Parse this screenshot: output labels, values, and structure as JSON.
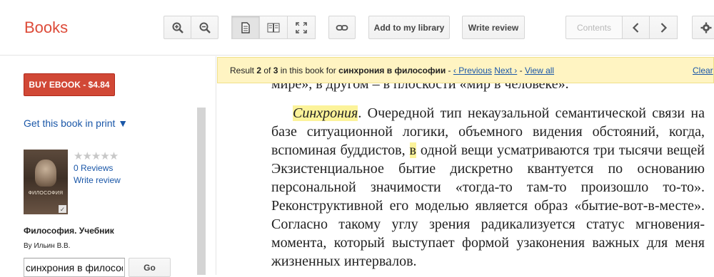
{
  "app": {
    "title": "Books"
  },
  "toolbar": {
    "zoom_in_icon": "zoom-in-icon",
    "zoom_out_icon": "zoom-out-icon",
    "view_single_icon": "single-page-icon",
    "view_two_icon": "two-page-icon",
    "fullscreen_icon": "fullscreen-icon",
    "link_icon": "link-icon",
    "add_to_library": "Add to my library",
    "write_review": "Write review",
    "contents": "Contents",
    "prev_icon": "chevron-left-icon",
    "next_icon": "chevron-right-icon",
    "settings_icon": "gear-icon"
  },
  "sidebar": {
    "buy_button": "BUY EBOOK - $4.84",
    "get_in_print": "Get this book in print ▼",
    "cover_title": "ФИЛОСОФИЯ",
    "rating_stars": "★★★★★",
    "rating_value": 0,
    "reviews": "0 Reviews",
    "write_review": "Write review",
    "book_title": "Философия. Учебник",
    "author": "By Ильин В.В.",
    "search_value": "синхрония в философии",
    "go_button": "Go"
  },
  "result_bar": {
    "prefix": "Result ",
    "current": "2",
    "of": " of ",
    "total": "3",
    "mid": " in this book for ",
    "query": "синхрония в философии",
    "sep1": " - ",
    "previous": "‹ Previous",
    "next": "Next ›",
    "sep2": " - ",
    "view_all": "View all",
    "clear": "Clear"
  },
  "page_text": {
    "cut_line": "мире», в другом – в плоскости «мир в человеке».",
    "highlight_word": "Синхрония",
    "part1": ". Очередной тип некаузальной семантической связи на базе ситуационной логики, объемного видения обстояний, когда, вспоминая буддистов, ",
    "highlight_letter": "в",
    "part2": " одной вещи усматриваются три тысячи вещей Экзистенциальное бытие дискретно квантуется по основанию персональной значимости «тогда-то там-то произошло то-то». Реконструктивной его моделью является образ «бытие-вот-в-месте». Согласно такому углу зрения радикализуется статус мгновения-момента, который выступает формой узаконения важных для меня жизненных интервалов."
  },
  "colors": {
    "brand": "#dd4b39",
    "buy_button": "#d14836",
    "link": "#1a57a8",
    "result_bar": "#fff4c2",
    "highlight": "#fcf39a"
  }
}
